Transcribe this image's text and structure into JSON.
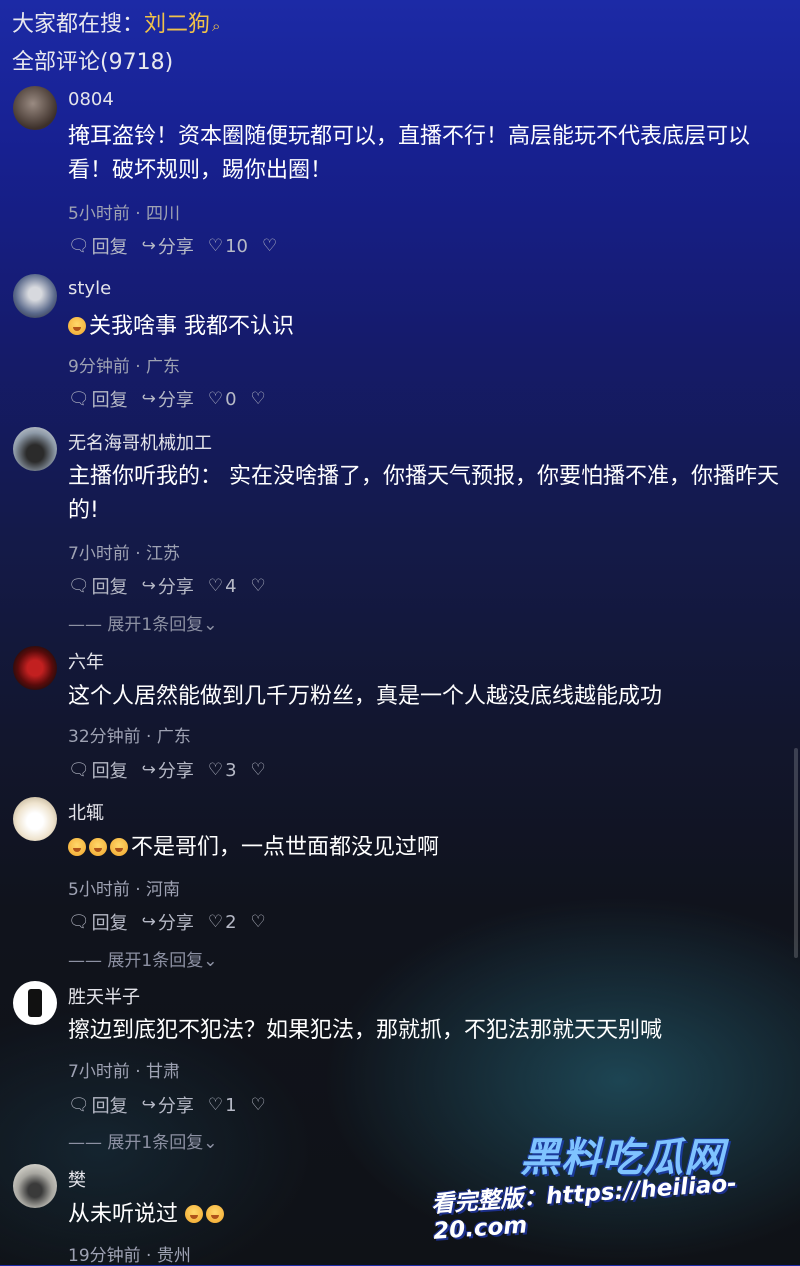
{
  "header": {
    "search_prefix": "大家都在搜：",
    "search_keyword": "刘二狗",
    "search_icon": "search-icon",
    "comment_count_label": "全部评论(9718)"
  },
  "labels": {
    "reply": "回复",
    "share": "分享",
    "expand_prefix": "——",
    "expand_text": "展开1条回复"
  },
  "comments": [
    {
      "user": "0804",
      "text": "掩耳盗铃！资本圈随便玩都可以，直播不行！高层能玩不代表底层可以看！破坏规则，踢你出圈！",
      "time": "5小时前 · 四川",
      "likes": "10"
    },
    {
      "user": "style",
      "text": "关我啥事 我都不认识",
      "time": "9分钟前 · 广东",
      "likes": "0"
    },
    {
      "user": "无名海哥机械加工",
      "text": "主播你听我的： 实在没啥播了，你播天气预报，你要怕播不准，你播昨天的!",
      "time": "7小时前 · 江苏",
      "likes": "4"
    },
    {
      "user": "六年",
      "text": "这个人居然能做到几千万粉丝，真是一个人越没底线越能成功",
      "time": "32分钟前 · 广东",
      "likes": "3"
    },
    {
      "user": "北辄",
      "text": "不是哥们，一点世面都没见过啊",
      "time": "5小时前 · 河南",
      "likes": "2"
    },
    {
      "user": "胜天半子",
      "text": "擦边到底犯不犯法？如果犯法，那就抓，不犯法那就天天别喊",
      "time": "7小时前 · 甘肃",
      "likes": "1"
    },
    {
      "user": "樊",
      "text": "从未听说过",
      "time": "19分钟前 · 贵州",
      "likes": ""
    }
  ],
  "watermark": {
    "title": "黑料吃瓜网",
    "text": "看完整版：https://heiliao-20.com"
  }
}
